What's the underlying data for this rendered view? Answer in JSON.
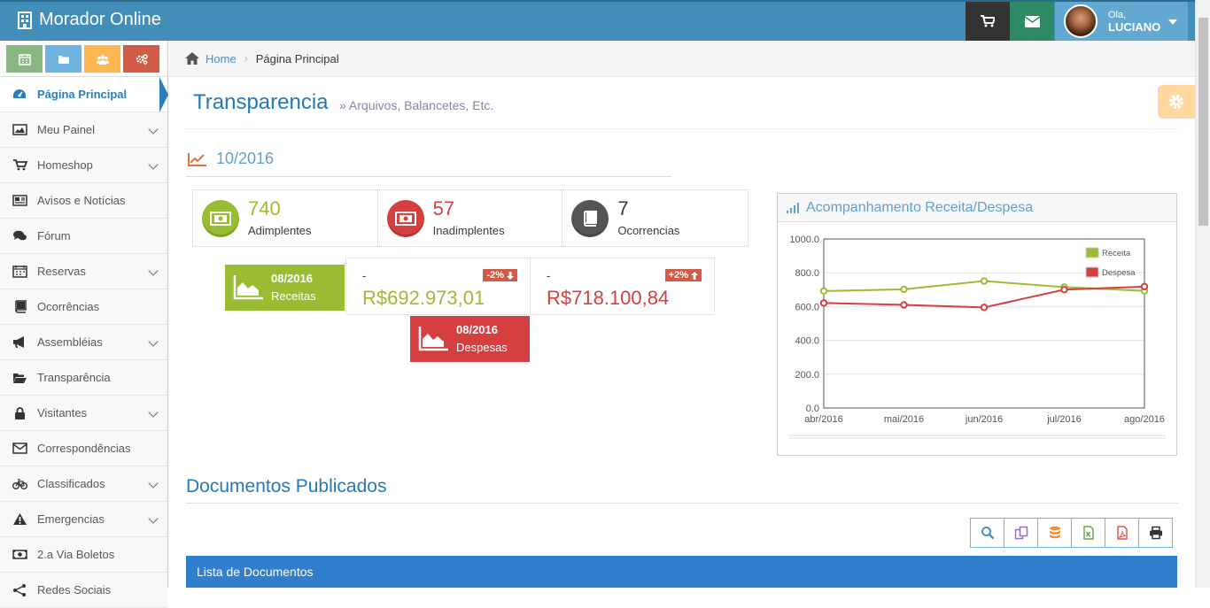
{
  "app": {
    "title": "Morador Online"
  },
  "topbar": {
    "greeting": "Ola,",
    "username": "LUCIANO",
    "cart_icon": "cart-icon",
    "mail_icon": "envelope-icon"
  },
  "shortcuts": [
    {
      "icon": "calendar-icon",
      "color": "#87b87f"
    },
    {
      "icon": "folder-icon",
      "color": "#6fb3e0"
    },
    {
      "icon": "users-icon",
      "color": "#ffb752"
    },
    {
      "icon": "cogs-icon",
      "color": "#d15b47"
    }
  ],
  "sidebar": {
    "items": [
      {
        "label": "Página Principal",
        "icon": "dashboard-icon",
        "active": true,
        "submenu": false
      },
      {
        "label": "Meu Painel",
        "icon": "picture-icon",
        "submenu": true
      },
      {
        "label": "Homeshop",
        "icon": "cart-icon",
        "submenu": true
      },
      {
        "label": "Avisos e Notícias",
        "icon": "newspaper-icon",
        "submenu": false
      },
      {
        "label": "Fórum",
        "icon": "comments-icon",
        "submenu": false
      },
      {
        "label": "Reservas",
        "icon": "calendar-icon",
        "submenu": true
      },
      {
        "label": "Ocorrências",
        "icon": "book-icon",
        "submenu": false
      },
      {
        "label": "Assembléias",
        "icon": "bullhorn-icon",
        "submenu": true
      },
      {
        "label": "Transparência",
        "icon": "folder-open-icon",
        "submenu": false
      },
      {
        "label": "Visitantes",
        "icon": "lock-icon",
        "submenu": true
      },
      {
        "label": "Correspondências",
        "icon": "envelope-icon",
        "submenu": false
      },
      {
        "label": "Classificados",
        "icon": "bicycle-icon",
        "submenu": true
      },
      {
        "label": "Emergencias",
        "icon": "warning-icon",
        "submenu": true
      },
      {
        "label": "2.a Via Boletos",
        "icon": "money-icon",
        "submenu": false
      },
      {
        "label": "Redes Sociais",
        "icon": "share-icon",
        "submenu": false
      }
    ]
  },
  "breadcrumb": {
    "home": "Home",
    "current": "Página Principal"
  },
  "page": {
    "title": "Transparencia",
    "subtitle": "» Arquivos, Balancetes, Etc.",
    "period": "10/2016"
  },
  "stats": [
    {
      "value": "740",
      "label": "Adimplentes",
      "color": "#9abc32"
    },
    {
      "value": "57",
      "label": "Inadimplentes",
      "color": "#d53f40"
    },
    {
      "value": "7",
      "label": "Ocorrencias",
      "color": "#393939"
    }
  ],
  "finance": {
    "receitas": {
      "period": "08/2016",
      "label": "Receitas",
      "dash": "-",
      "value": "R$692.973,01",
      "badge": "-2%",
      "color": "#9abc32"
    },
    "despesas": {
      "period": "08/2016",
      "label": "Despesas",
      "dash": "-",
      "value": "R$718.100,84",
      "badge": "+2%",
      "color": "#d53f40"
    }
  },
  "widget": {
    "title": "Acompanhamento Receita/Despesa"
  },
  "chart_data": {
    "type": "line",
    "title": "Acompanhamento Receita/Despesa",
    "categories": [
      "abr/2016",
      "mai/2016",
      "jun/2016",
      "jul/2016",
      "ago/2016"
    ],
    "series": [
      {
        "name": "Receita",
        "values": [
          692,
          702,
          751,
          715,
          693
        ],
        "color": "#9abc32"
      },
      {
        "name": "Despesa",
        "values": [
          621,
          610,
          595,
          700,
          718
        ],
        "color": "#d53f40"
      }
    ],
    "y_ticks": [
      "0.0",
      "200.0",
      "400.0",
      "600.0",
      "800.0",
      "1000.0"
    ],
    "ylim": [
      0,
      1000
    ],
    "grid": true,
    "legend": "top-right"
  },
  "documents": {
    "title": "Documentos Publicados",
    "table_title": "Lista de Documentos"
  },
  "toolbar": [
    {
      "icon": "search-icon",
      "color": "#478fca"
    },
    {
      "icon": "copy-icon",
      "color": "#a069c3"
    },
    {
      "icon": "database-icon",
      "color": "#ff892a"
    },
    {
      "icon": "excel-icon",
      "color": "#69aa46"
    },
    {
      "icon": "pdf-icon",
      "color": "#dd5a43"
    },
    {
      "icon": "print-icon",
      "color": "#333333"
    }
  ]
}
